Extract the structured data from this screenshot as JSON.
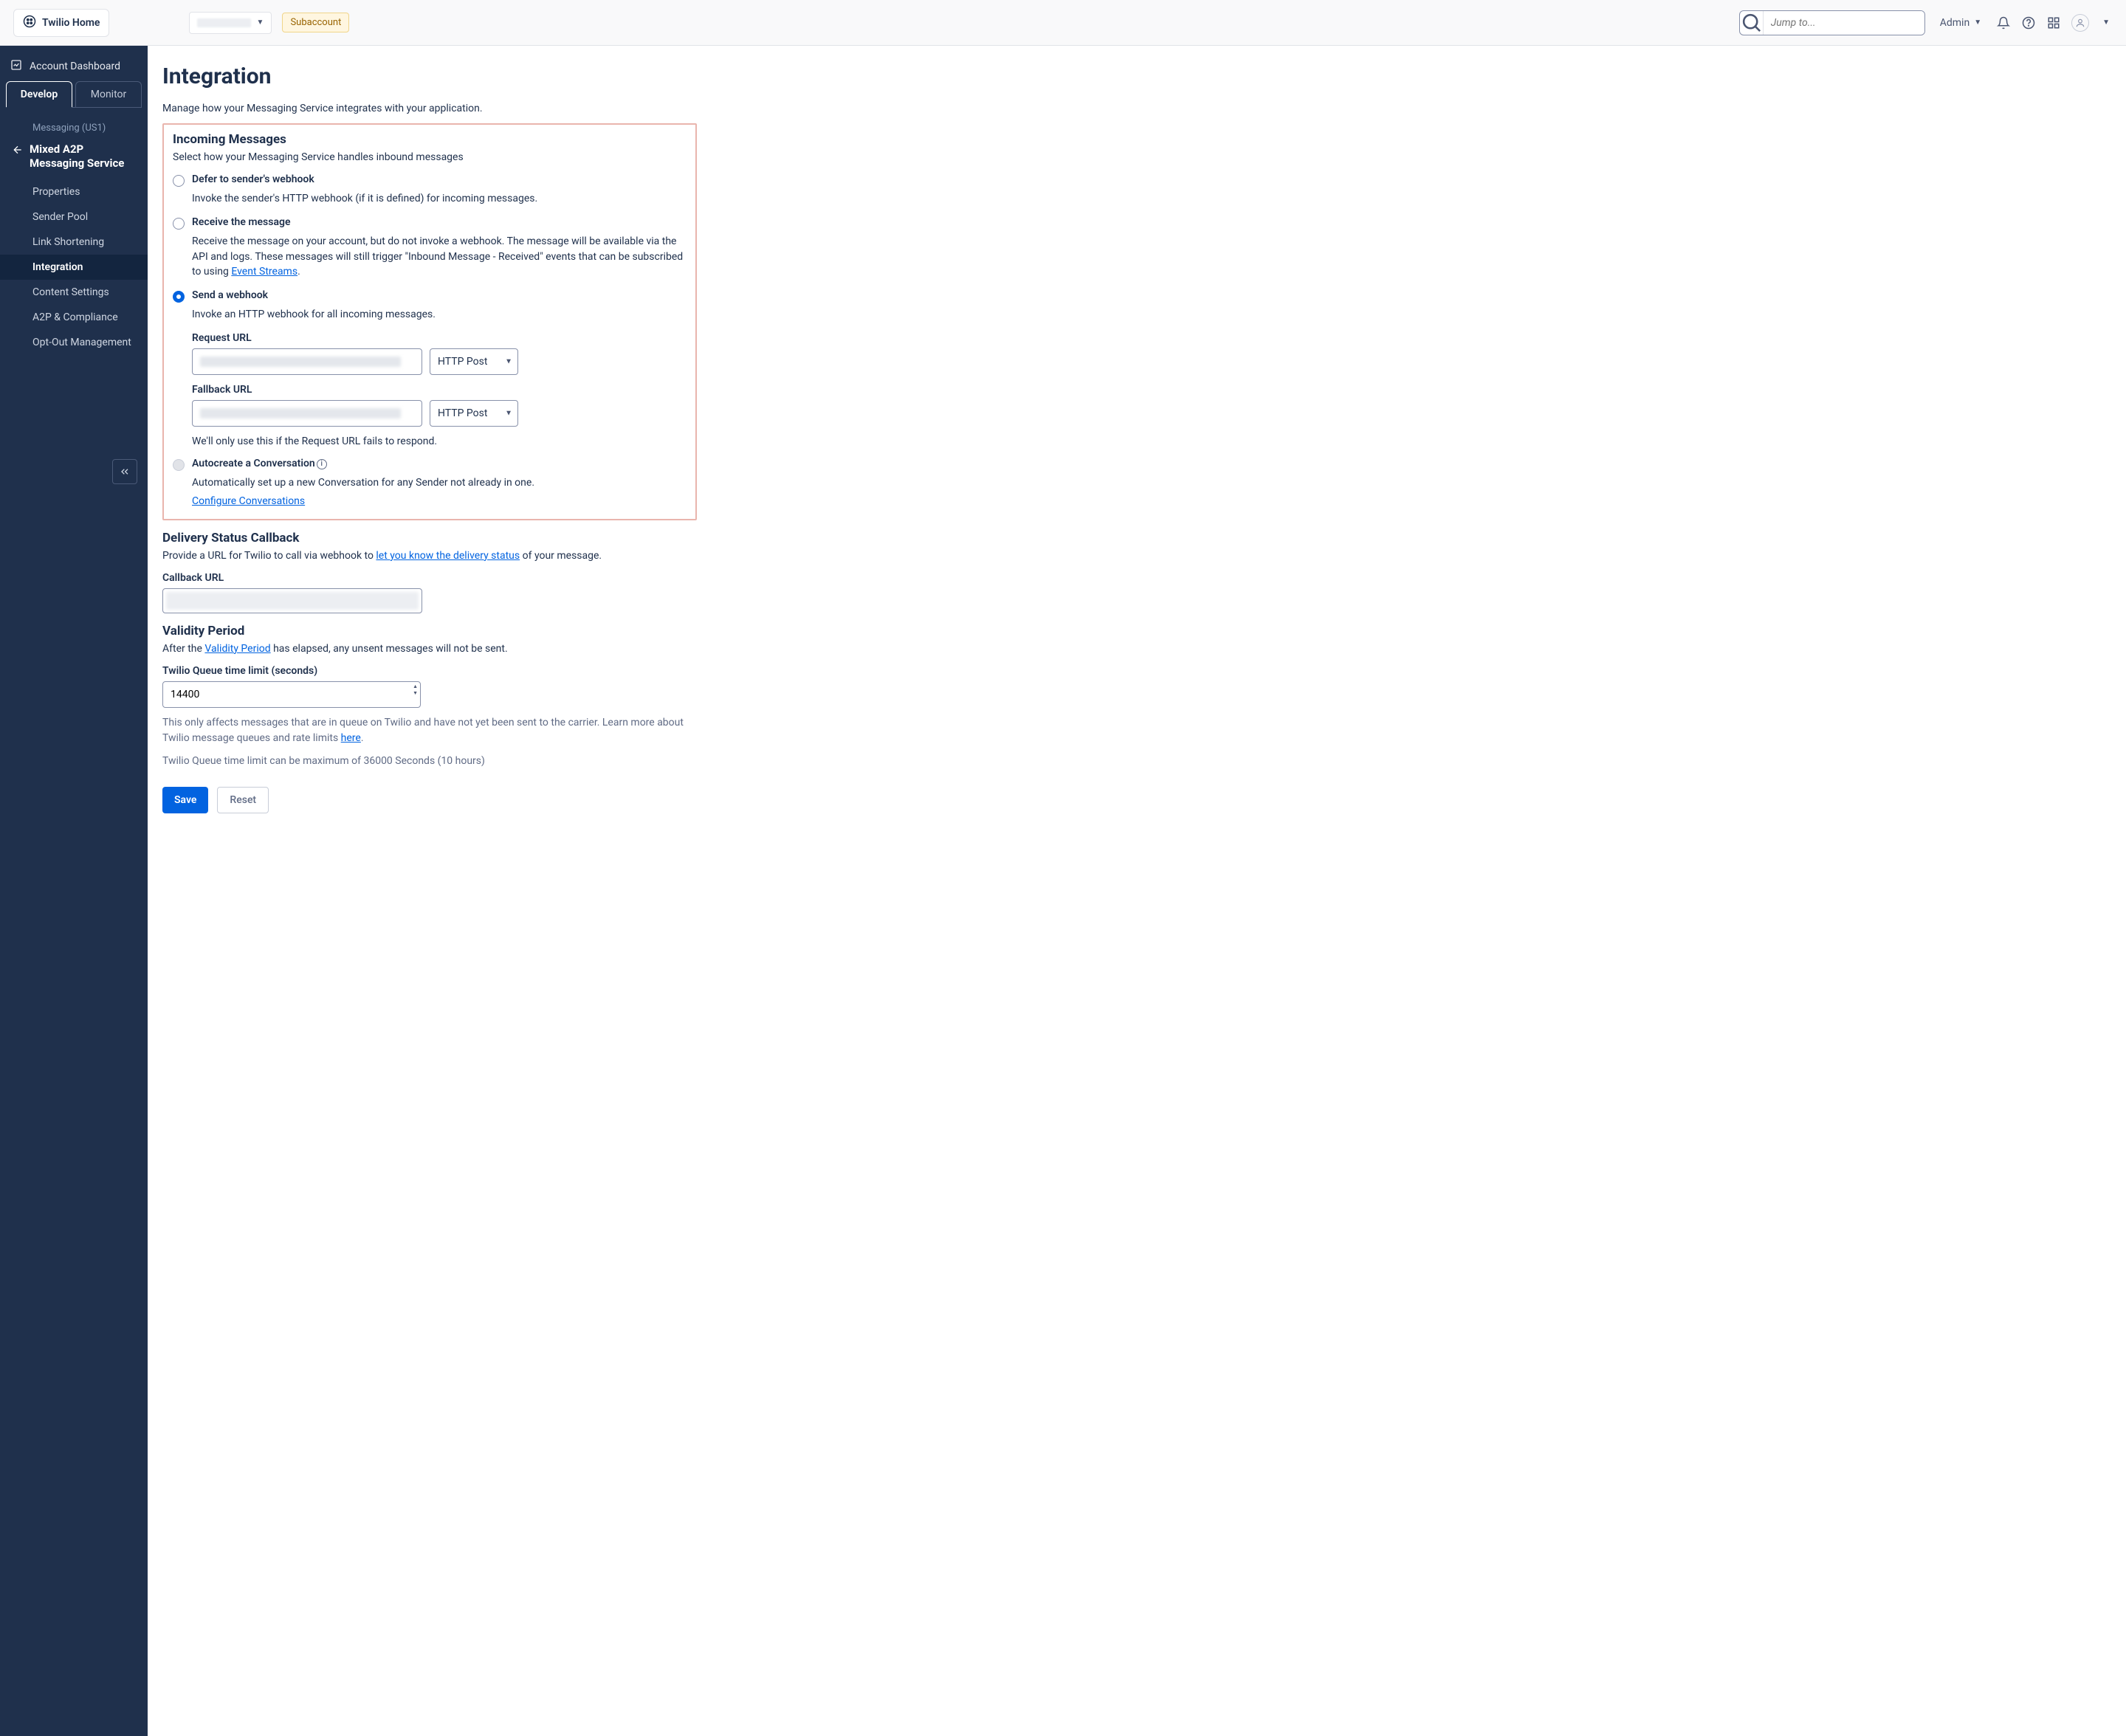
{
  "topbar": {
    "home": "Twilio Home",
    "subaccount_badge": "Subaccount",
    "search_placeholder": "Jump to...",
    "admin_label": "Admin"
  },
  "sidebar": {
    "dashboard": "Account Dashboard",
    "tabs": {
      "develop": "Develop",
      "monitor": "Monitor"
    },
    "crumb": "Messaging (US1)",
    "service_name": "Mixed A2P Messaging Service",
    "items": [
      "Properties",
      "Sender Pool",
      "Link Shortening",
      "Integration",
      "Content Settings",
      "A2P & Compliance",
      "Opt-Out Management"
    ],
    "active_index": 3
  },
  "page": {
    "title": "Integration",
    "subtitle": "Manage how your Messaging Service integrates with your application."
  },
  "incoming": {
    "heading": "Incoming Messages",
    "desc": "Select how your Messaging Service handles inbound messages",
    "options": {
      "defer": {
        "label": "Defer to sender's webhook",
        "desc": "Invoke the sender's HTTP webhook (if it is defined) for incoming messages."
      },
      "receive": {
        "label": "Receive the message",
        "desc_a": "Receive the message on your account, but do not invoke a webhook. The message will be available via the API and logs. These messages will still trigger \"Inbound Message - Received\" events that can be subscribed to using ",
        "link": "Event Streams",
        "desc_b": "."
      },
      "webhook": {
        "label": "Send a webhook",
        "desc": "Invoke an HTTP webhook for all incoming messages."
      },
      "auto": {
        "label": "Autocreate a Conversation",
        "desc": "Automatically set up a new Conversation for any Sender not already in one.",
        "link": "Configure Conversations"
      }
    },
    "selected": "webhook",
    "request_url": {
      "label": "Request URL",
      "method": "HTTP Post"
    },
    "fallback_url": {
      "label": "Fallback URL",
      "method": "HTTP Post",
      "hint": "We'll only use this if the Request URL fails to respond."
    }
  },
  "delivery": {
    "heading": "Delivery Status Callback",
    "desc_a": "Provide a URL for Twilio to call via webhook to ",
    "link": "let you know the delivery status",
    "desc_b": " of your message.",
    "label": "Callback URL"
  },
  "validity": {
    "heading": "Validity Period",
    "desc_a": "After the ",
    "link": "Validity Period",
    "desc_b": " has elapsed, any unsent messages will not be sent.",
    "label": "Twilio Queue time limit (seconds)",
    "value": "14400",
    "help_a": "This only affects messages that are in queue on Twilio and have not yet been sent to the carrier. Learn more about Twilio message queues and rate limits ",
    "help_link": "here",
    "help_b": ".",
    "help2": "Twilio Queue time limit can be maximum of 36000 Seconds (10 hours)"
  },
  "actions": {
    "save": "Save",
    "reset": "Reset"
  }
}
